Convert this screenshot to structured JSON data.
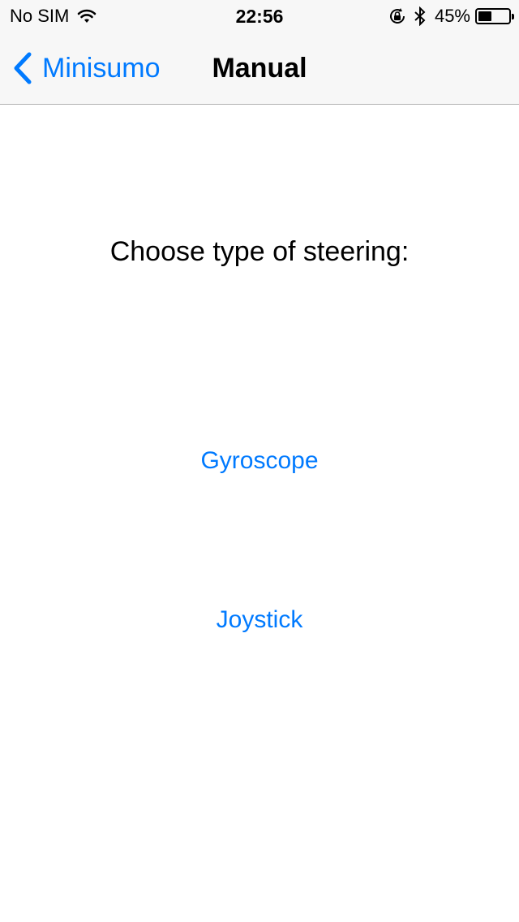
{
  "status_bar": {
    "carrier": "No SIM",
    "time": "22:56",
    "battery_percent_label": "45%",
    "battery_level": 0.45
  },
  "nav": {
    "back_label": "Minisumo",
    "title": "Manual"
  },
  "main": {
    "prompt": "Choose type of steering:",
    "options": [
      {
        "label": "Gyroscope"
      },
      {
        "label": "Joystick"
      }
    ]
  },
  "colors": {
    "accent": "#007aff",
    "bar_background": "#f7f7f7"
  },
  "icons": [
    "wifi-icon",
    "orientation-lock-icon",
    "bluetooth-icon",
    "battery-icon",
    "chevron-left-icon"
  ]
}
